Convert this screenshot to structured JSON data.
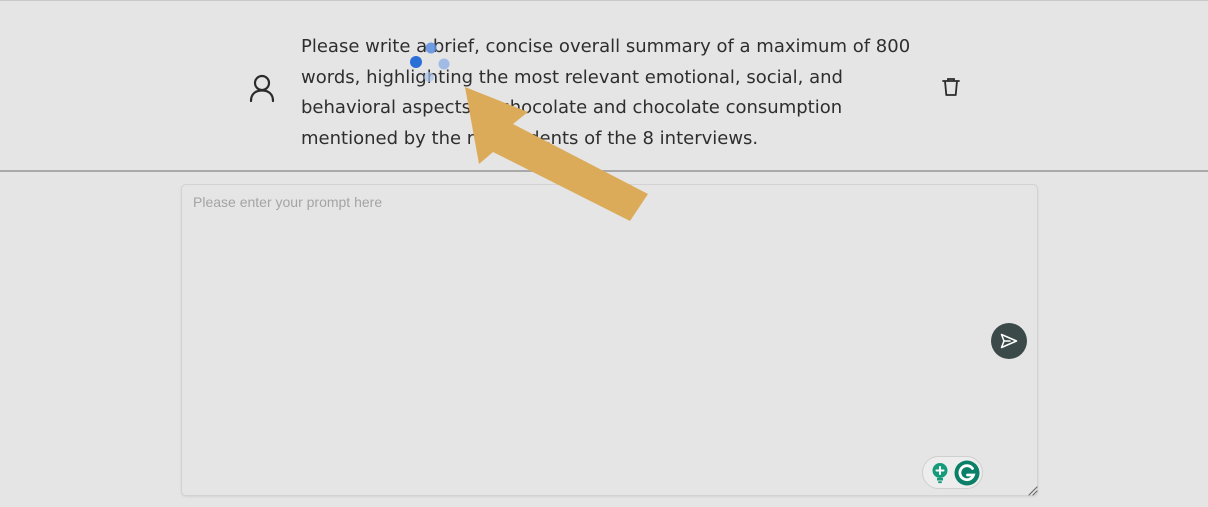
{
  "message": {
    "text": "Please write a brief, concise overall summary of a maximum of 800 words, highlighting the most relevant emotional, social, and behavioral aspects of chocolate and chocolate consumption mentioned by the respondents of the 8 interviews."
  },
  "prompt": {
    "placeholder": "Please enter your prompt here",
    "value": ""
  },
  "icons": {
    "user": "user-icon",
    "trash": "trash-icon",
    "send": "send-icon",
    "bulb": "lightbulb-plus-icon",
    "grammarly": "grammarly-icon",
    "loading": "loading-dots-icon",
    "pointer": "arrow-icon"
  },
  "colors": {
    "background": "#e5e5e5",
    "send_button": "#3b4a48",
    "loading_dot": "#2a6fd6",
    "grammarly": "#0b8a6f",
    "arrow": "#dcab5a"
  }
}
